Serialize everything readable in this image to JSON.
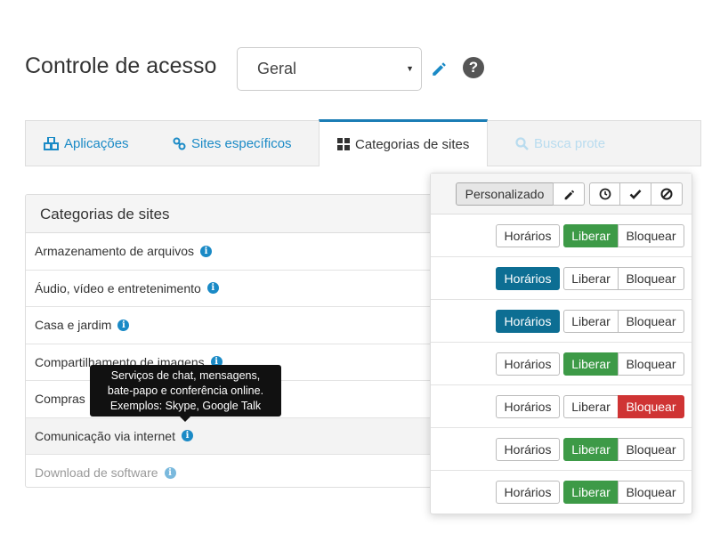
{
  "header": {
    "title": "Controle de acesso",
    "select_value": "Geral"
  },
  "tabs": [
    {
      "label": "Aplicações",
      "icon": "cubes-icon"
    },
    {
      "label": "Sites específicos",
      "icon": "link-icon"
    },
    {
      "label": "Categorias de sites",
      "icon": "grid-icon"
    },
    {
      "label": "Busca prote",
      "icon": "search-icon"
    }
  ],
  "panel": {
    "title": "Categorias de sites",
    "rows": [
      "Armazenamento de arquivos",
      "Áudio, vídeo e entretenimento",
      "Casa e jardim",
      "Compartilhamento de imagens",
      "Compras",
      "Comunicação via internet",
      "Download de software"
    ]
  },
  "tooltip": {
    "line1": "Serviços de chat, mensagens,",
    "line2": "bate-papo e conferência online.",
    "line3": "Exemplos: Skype, Google Talk"
  },
  "toolbar": {
    "mode_label": "Personalizado"
  },
  "labels": {
    "horarios": "Horários",
    "liberar": "Liberar",
    "bloquear": "Bloquear"
  },
  "rule_states": [
    "liberar",
    "horarios",
    "horarios",
    "liberar",
    "bloquear",
    "liberar",
    "liberar"
  ],
  "colors": {
    "accent": "#1a8ac6",
    "horarios_on": "#0d6e93",
    "liberar_on": "#3d9a47",
    "bloquear_on": "#cf3434"
  }
}
